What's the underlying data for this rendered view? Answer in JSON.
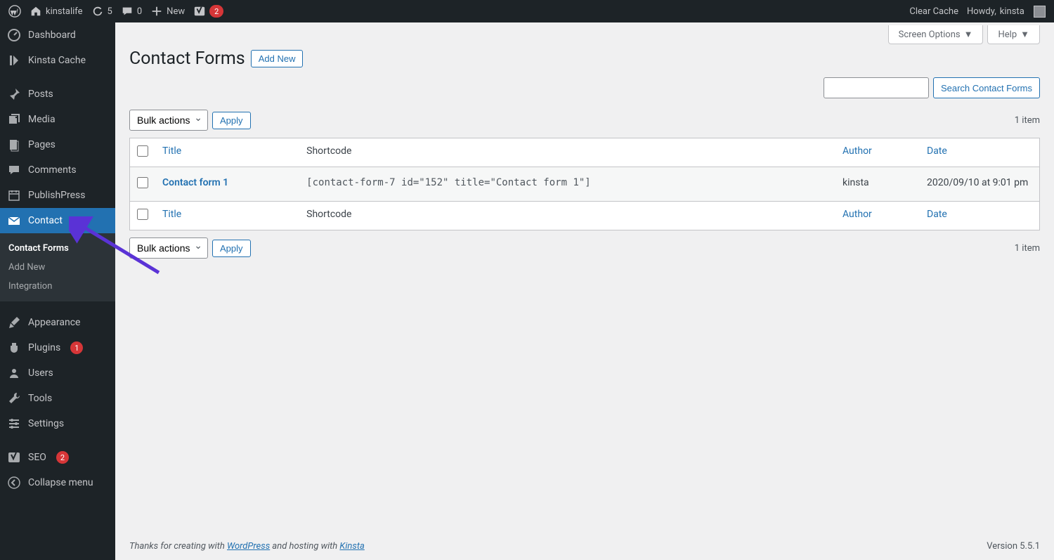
{
  "adminbar": {
    "site_name": "kinstalife",
    "refresh_count": "5",
    "comment_count": "0",
    "new_label": "New",
    "yoast_badge": "2",
    "clear_cache": "Clear Cache",
    "howdy_prefix": "Howdy, ",
    "user_name": "kinsta"
  },
  "sidebar": {
    "dashboard": "Dashboard",
    "kinsta_cache": "Kinsta Cache",
    "posts": "Posts",
    "media": "Media",
    "pages": "Pages",
    "comments": "Comments",
    "publishpress": "PublishPress",
    "contact": "Contact",
    "appearance": "Appearance",
    "plugins": "Plugins",
    "plugins_count": "1",
    "users": "Users",
    "tools": "Tools",
    "settings": "Settings",
    "seo": "SEO",
    "seo_count": "2",
    "collapse": "Collapse menu"
  },
  "submenu": {
    "contact_forms": "Contact Forms",
    "add_new": "Add New",
    "integration": "Integration"
  },
  "header": {
    "title": "Contact Forms",
    "add_new": "Add New",
    "screen_options": "Screen Options",
    "help": "Help"
  },
  "search": {
    "button": "Search Contact Forms"
  },
  "bulk": {
    "label": "Bulk actions",
    "apply": "Apply"
  },
  "count": "1 item",
  "table": {
    "col_title": "Title",
    "col_shortcode": "Shortcode",
    "col_author": "Author",
    "col_date": "Date",
    "rows": [
      {
        "title": "Contact form 1",
        "shortcode": "[contact-form-7 id=\"152\" title=\"Contact form 1\"]",
        "author": "kinsta",
        "date": "2020/09/10 at 9:01 pm"
      }
    ]
  },
  "footer": {
    "thanks_1": "Thanks for creating with ",
    "wordpress": "WordPress",
    "thanks_2": " and hosting with ",
    "kinsta": "Kinsta",
    "version": "Version 5.5.1"
  }
}
